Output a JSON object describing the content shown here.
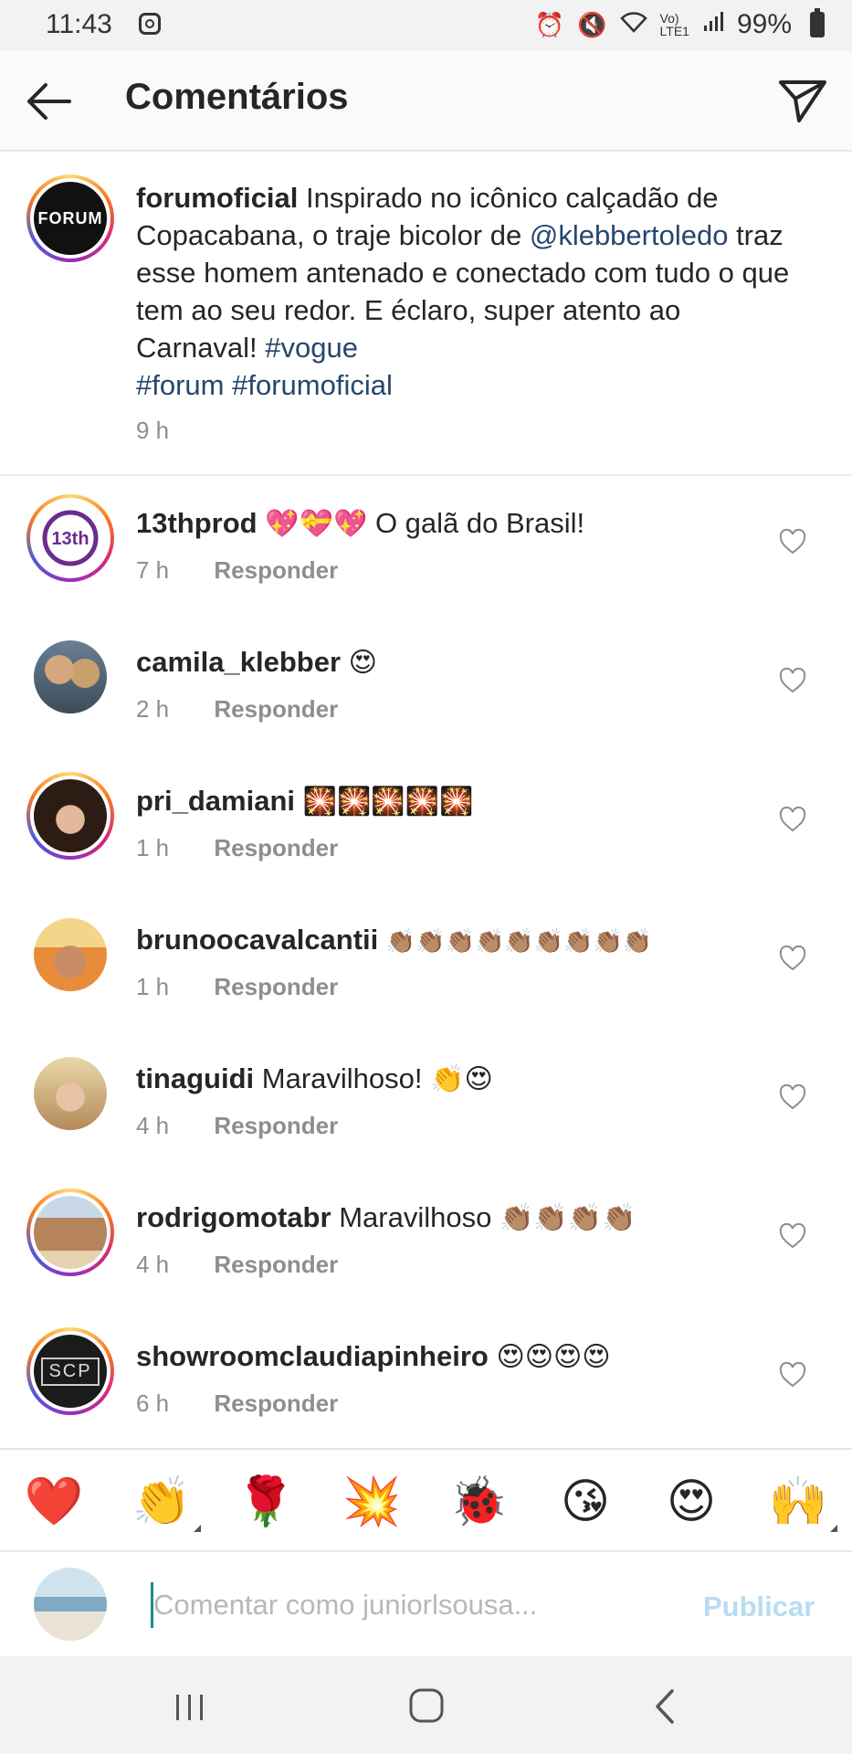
{
  "status_bar": {
    "time": "11:43",
    "battery": "99%",
    "icons": [
      "instagram-icon",
      "alarm-icon",
      "mute-icon",
      "wifi-icon",
      "volte-icon",
      "signal-icon",
      "battery-icon"
    ]
  },
  "header": {
    "title": "Comentários",
    "back_icon": "arrow-left-icon",
    "send_icon": "paper-plane-icon"
  },
  "caption": {
    "avatar_text": "FORUM",
    "username": "forumoficial",
    "text_1": " Inspirado no icônico calçadão de Copacabana, o traje bicolor de ",
    "mention": "@klebbertoledo",
    "text_2": " traz esse homem antenado e conectado com tudo o que tem ao seu redor. E éclaro, super atento ao Carnaval! ",
    "hashtag_1": "#vogue",
    "hashtag_2": "#forum",
    "hashtag_3": "#forumoficial",
    "time": "9 h"
  },
  "reply_label": "Responder",
  "comments": [
    {
      "username": "13thprod",
      "emoji": "💖💝💖",
      "text": "O galã do Brasil!",
      "time": "7 h",
      "avatar_text": "13th"
    },
    {
      "username": "camila_klebber",
      "emoji": "😍",
      "text": "",
      "time": "2 h"
    },
    {
      "username": "pri_damiani",
      "emoji": "🎇🎇🎇🎇🎇",
      "text": "",
      "time": "1 h"
    },
    {
      "username": "brunoocavalcantii",
      "emoji": "👏🏽👏🏽👏🏽👏🏽👏🏽👏🏽👏🏽👏🏽👏🏽",
      "text": "",
      "time": "1 h"
    },
    {
      "username": "tinaguidi",
      "emoji": "👏😍",
      "text": "Maravilhoso!",
      "time": "4 h"
    },
    {
      "username": "rodrigomotabr",
      "emoji": "👏🏽👏🏽👏🏽👏🏽",
      "text": "Maravilhoso",
      "time": "4 h"
    },
    {
      "username": "showroomclaudiapinheiro",
      "emoji": "😍😍😍😍",
      "text": "",
      "time": "6 h",
      "avatar_text": "SCP"
    }
  ],
  "emoji_bar": [
    "❤️",
    "👏",
    "🌹",
    "💥",
    "🐞",
    "😘",
    "😍",
    "🙌"
  ],
  "input": {
    "placeholder": "Comentar como juniorlsousa...",
    "publish_label": "Publicar"
  },
  "nav": {
    "recents_icon": "recents-icon",
    "home_icon": "home-icon",
    "back_icon": "back-chevron-icon"
  }
}
